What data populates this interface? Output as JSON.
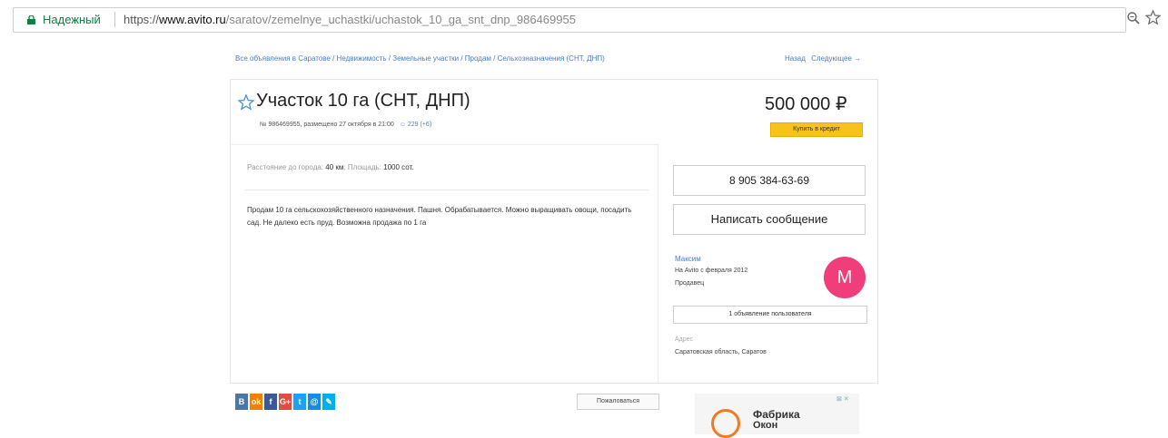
{
  "browser": {
    "secure_label": "Надежный",
    "url_proto": "https://",
    "url_host": "www.avito.ru",
    "url_path": "/saratov/zemelnye_uchastki/uchastok_10_ga_snt_dnp_986469955"
  },
  "breadcrumb": "Все объявления в Саратове / Недвижимость / Земельные участки / Продам / Сельхозназначения (СНТ, ДНП)",
  "nav": {
    "back": "Назад",
    "next": "Следующее →"
  },
  "listing": {
    "title": "Участок 10 га (СНТ, ДНП)",
    "meta": "№ 986469955, размещено 27 октября в 21:00",
    "views": "☺ 229 (+6)",
    "price": "500 000 ₽",
    "credit_button": "Купить в кредит",
    "params": {
      "distance_label": "Расстояние до города:",
      "distance_value": "40 км",
      "area_label": "Площадь:",
      "area_value": "1000 сот."
    },
    "description": "Продам 10 га сельскохозяйственного назначения. Пашня. Обрабатывается. Можно выращивать овощи, посадить сад. Не далеко есть пруд. Возможна продажа по 1 га"
  },
  "seller": {
    "phone": "8 905 384-63-69",
    "message_button": "Написать сообщение",
    "name": "Максим",
    "since": "На Avito с февраля 2012",
    "role": "Продавец",
    "avatar_letter": "M",
    "ads_button": "1 объявление пользователя",
    "address_label": "Адрес",
    "address_value": "Саратовская область, Саратов"
  },
  "share": {
    "buttons": [
      {
        "icon": "vk-icon",
        "glyph": "B",
        "color": "#4a76a8"
      },
      {
        "icon": "ok-icon",
        "glyph": "ok",
        "color": "#ee8208"
      },
      {
        "icon": "facebook-icon",
        "glyph": "f",
        "color": "#3b5998"
      },
      {
        "icon": "google-plus-icon",
        "glyph": "G+",
        "color": "#dc4e41"
      },
      {
        "icon": "twitter-icon",
        "glyph": "t",
        "color": "#1da1f2"
      },
      {
        "icon": "mail-icon",
        "glyph": "@",
        "color": "#168de2"
      },
      {
        "icon": "livejournal-icon",
        "glyph": "✎",
        "color": "#00b0ea"
      }
    ],
    "complain": "Пожаловаться"
  },
  "ad": {
    "mark": "⊠ ✕",
    "line1": "Фабрика",
    "line2": "Окон"
  },
  "colors": {
    "accent": "#4a7fc2",
    "credit": "#f9c11c",
    "avatar": "#ef3e7a"
  }
}
